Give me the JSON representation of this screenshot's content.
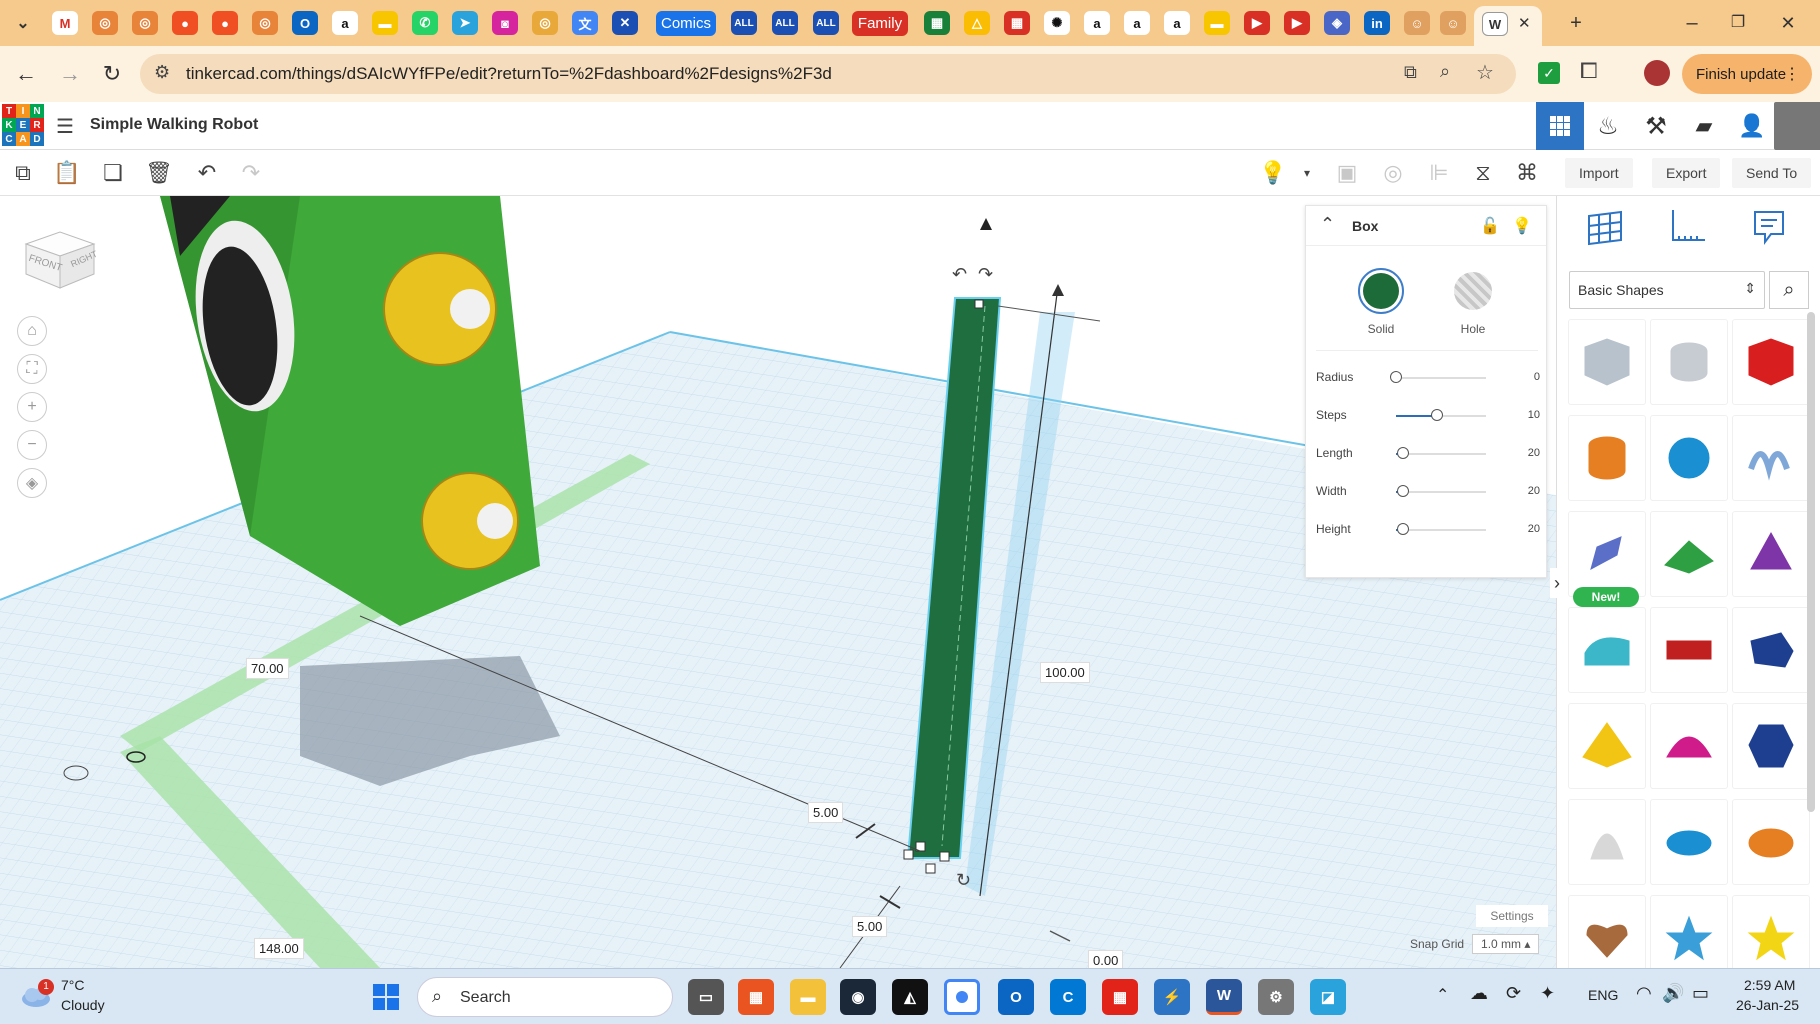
{
  "browser": {
    "tabs": [
      {
        "label": "Comics",
        "color": "#1a73e8"
      },
      {
        "label": "ALL",
        "color": "#1b4fb4"
      },
      {
        "label": "ALL",
        "color": "#1b4fb4"
      },
      {
        "label": "ALL",
        "color": "#1b4fb4"
      },
      {
        "label": "Family",
        "color": "#d93025"
      }
    ],
    "url": "tinkercad.com/things/dSAIcWYfFPe/edit?returnTo=%2Fdashboard%2Fdesigns%2F3d",
    "finish_update": "Finish update",
    "window_controls": {
      "minimize": "–",
      "maximize": "❐",
      "close": "✕"
    },
    "new_tab": "+"
  },
  "header": {
    "logo_letters": [
      "T",
      "I",
      "N",
      "K",
      "E",
      "R",
      "C",
      "A",
      "D"
    ],
    "design_title": "Simple Walking Robot"
  },
  "toolbar": {
    "import_label": "Import",
    "export_label": "Export",
    "send_to_label": "Send To"
  },
  "viewcube": {
    "front": "FRONT",
    "right": "RIGHT"
  },
  "dimensions": {
    "d70": "70.00",
    "d100": "100.00",
    "d5a": "5.00",
    "d5b": "5.00",
    "d148": "148.00",
    "d0": "0.00"
  },
  "inspector": {
    "title": "Box",
    "solid_label": "Solid",
    "hole_label": "Hole",
    "solid_color": "#1e6b3a",
    "props": [
      {
        "name": "Radius",
        "value": "0",
        "level": 0.0
      },
      {
        "name": "Steps",
        "value": "10",
        "level": 0.45
      },
      {
        "name": "Length",
        "value": "20",
        "level": 0.08
      },
      {
        "name": "Width",
        "value": "20",
        "level": 0.08
      },
      {
        "name": "Height",
        "value": "20",
        "level": 0.08
      }
    ]
  },
  "library": {
    "category": "Basic Shapes",
    "new_badge": "New!",
    "shapes": [
      "box-hole",
      "cylinder-hole",
      "box",
      "cylinder",
      "sphere",
      "scribble",
      "shape-generator",
      "roof",
      "cone",
      "round-roof",
      "text",
      "polygon",
      "pyramid",
      "half-sphere",
      "hexagonal-prism",
      "paraboloid",
      "torus",
      "tube",
      "heart",
      "star",
      "star-yellow"
    ]
  },
  "workplane": {
    "settings_label": "Settings",
    "snap_grid_label": "Snap Grid",
    "snap_grid_value": "1.0 mm",
    "arrow": "›"
  },
  "taskbar": {
    "weather_temp": "7°C",
    "weather_cond": "Cloudy",
    "weather_badge": "1",
    "search_label": "Search",
    "lang": "ENG",
    "time": "2:59 AM",
    "date": "26-Jan-25"
  }
}
